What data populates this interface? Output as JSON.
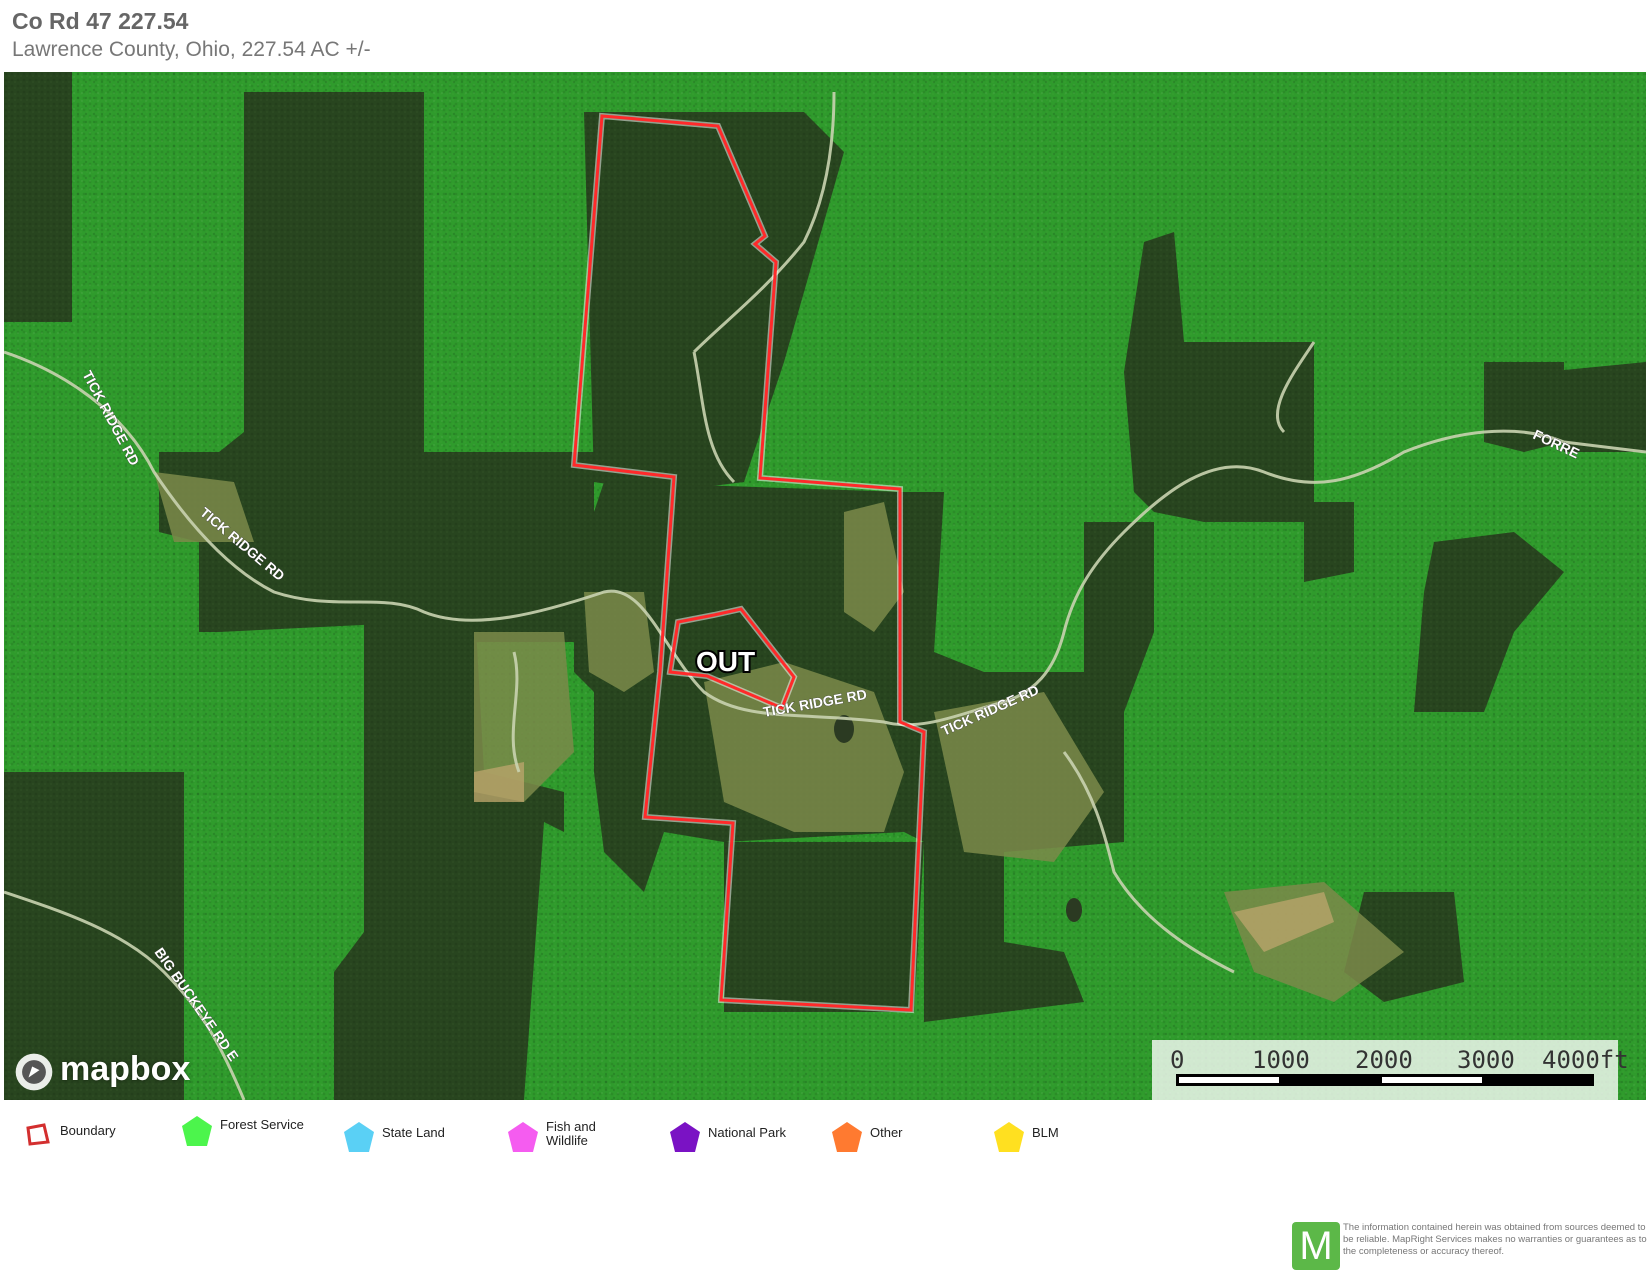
{
  "header": {
    "title": "Co Rd 47 227.54",
    "subtitle": "Lawrence County, Ohio, 227.54 AC +/-"
  },
  "map": {
    "roads": [
      "TICK RIDGE RD",
      "TICK RIDGE RD",
      "TICK RIDGE RD",
      "TICK RIDGE RD",
      "BIG BUCKEYE RD E",
      "FORRE"
    ],
    "excluded_label": "OUT",
    "boundary_color": "#ff2a2a",
    "forest_service_color": "#3cc43a",
    "attribution": "mapbox"
  },
  "scale": {
    "ticks": [
      "0",
      "1000",
      "2000",
      "3000",
      "4000ft"
    ]
  },
  "legend": [
    {
      "label": "Boundary",
      "icon": "boundary-icon",
      "color": "#d32f2f"
    },
    {
      "label": "Forest Service",
      "icon": "pentagon-icon",
      "color": "#4cf54c"
    },
    {
      "label": "State Land",
      "icon": "pentagon-icon",
      "color": "#5ad0f5"
    },
    {
      "label": "Fish and Wildlife",
      "icon": "pentagon-icon",
      "color": "#f55cf0"
    },
    {
      "label": "National Park",
      "icon": "pentagon-icon",
      "color": "#7a12c4"
    },
    {
      "label": "Other",
      "icon": "pentagon-icon",
      "color": "#ff7a30"
    },
    {
      "label": "BLM",
      "icon": "pentagon-icon",
      "color": "#ffe020"
    }
  ],
  "footer": {
    "logo_letter": "M",
    "disclaimer": "The information contained herein was obtained from sources deemed to be reliable. MapRight Services makes no warranties or guarantees as to the completeness or accuracy thereof."
  }
}
